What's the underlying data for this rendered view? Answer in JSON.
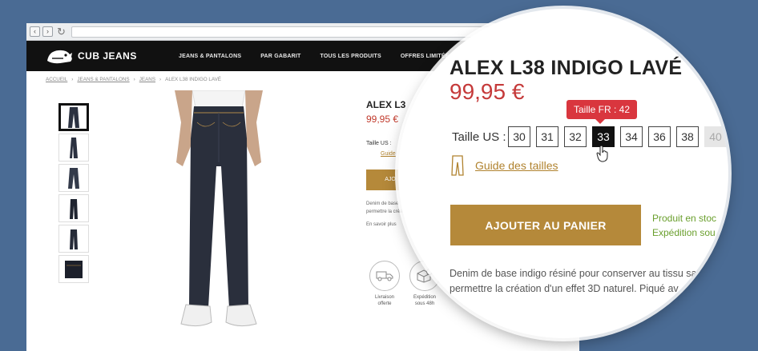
{
  "brand": {
    "name": "CUB JEANS",
    "logo_icon": "bear-cub-icon"
  },
  "nav": {
    "items": [
      "JEANS & PANTALONS",
      "PAR GABARIT",
      "TOUS LES PRODUITS",
      "OFFRES LIMITÉES"
    ]
  },
  "breadcrumb": [
    "ACCUEIL",
    "JEANS & PANTALONS",
    "JEANS",
    "ALEX L38 INDIGO LAVÉ"
  ],
  "product": {
    "title_partial": "ALEX L3",
    "title": "ALEX L38 INDIGO LAVÉ",
    "price": "99,95 €",
    "price_partial": "99,95 €",
    "size_label_small": "Taille US :",
    "size_label": "Taille US :",
    "sizes": [
      "30",
      "31",
      "32",
      "33",
      "34",
      "36",
      "38",
      "40"
    ],
    "selected_size": "33",
    "disabled_size": "40",
    "tooltip": "Taille FR : 42",
    "size_guide": "Guide des tailles",
    "size_guide_partial": "Guide",
    "add_to_cart": "AJOUTER AU PANIER",
    "add_to_cart_partial": "AJO",
    "stock_line1": "Produit en stoc",
    "stock_line2": "Expédition sou",
    "desc_line1": "Denim de base indigo résiné pour conserver au tissu sa",
    "desc_line2": "permettre la création d'un effet 3D naturel. Piqué av",
    "desc_small_line1": "Denim de base",
    "desc_small_line2": "permettre la créatio",
    "more": "plus",
    "more_small": "En savoir plus"
  },
  "features": [
    {
      "icon": "truck-icon",
      "line1": "Livraison",
      "line2": "offerte"
    },
    {
      "icon": "package-clock-icon",
      "line1": "Expédition",
      "line2": "sous 48h"
    }
  ],
  "colors": {
    "accent_gold": "#b5893a",
    "price_red": "#c53a3a",
    "tooltip_red": "#d9363e",
    "stock_green": "#6a9f2d",
    "page_bg": "#4a6b94"
  }
}
